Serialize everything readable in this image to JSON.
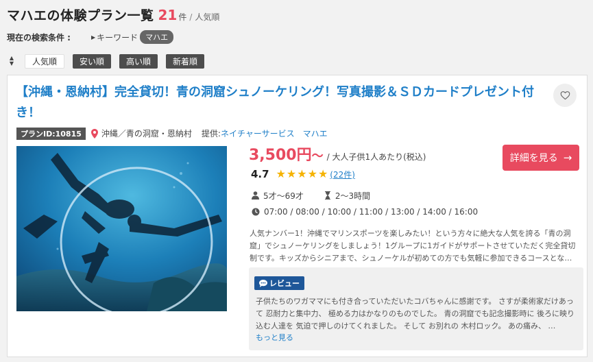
{
  "header": {
    "title": "マハエの体験プラン一覧",
    "count": "21",
    "count_unit": "件",
    "separator": "/",
    "sort_name": "人気順"
  },
  "search_conditions": {
    "label": "現在の検索条件 :",
    "keyword_label": "キーワード",
    "keyword_value": "マハエ"
  },
  "sort": {
    "icon": "sort-updown-icon",
    "options": [
      "人気順",
      "安い順",
      "高い順",
      "新着順"
    ],
    "active_index": 0
  },
  "plan": {
    "title": "【沖縄・恩納村】完全貸切！青の洞窟シュノーケリング！写真撮影＆ＳＤカードプレゼント付き！",
    "plan_id": "プランID:10815",
    "location": "沖縄／青の洞窟・恩納村",
    "provider_label": "提供:",
    "provider": "ネイチャーサービス　マハエ",
    "price": "3,500円",
    "price_suffix": "〜",
    "price_note": "/ 大人子供1人あたり(税込)",
    "detail_button": "詳細を見る",
    "rating": "4.7",
    "stars": 5,
    "review_count": "(22件)",
    "age": "5才〜69才",
    "duration": "2〜3時間",
    "times": "07:00 / 08:00 / 10:00 / 11:00 / 13:00 / 14:00 / 16:00",
    "description": "人気ナンバー1！沖縄でマリンスポーツを楽しみたい！という方々に絶大な人気を誇る「青の洞窟」でシュノーケリングをしましょう！1グループに1ガイドがサポートさせていただく完全貸切制です。キッズからシニアまで、シュノーケルが初めての方でも気軽に参加できるコースとな…",
    "review_badge": "レビュー",
    "review_text": "子供たちのワガママにも付き合っていただいたコバちゃんに感謝です。 さすが柔術家だけあって 忍耐力と集中力、 極める力はかなりのものでした。 青の洞窟でも記念撮影時に 後ろに映り込む人達を 気迫で押しのけてくれました。 そして お別れの 木村ロック。 あの痛み、 …",
    "more_link": "もっと見る"
  },
  "colors": {
    "accent_red": "#e84a5f",
    "link_blue": "#1f7fc8",
    "badge_navy": "#1e5799",
    "star_yellow": "#f5b301"
  }
}
